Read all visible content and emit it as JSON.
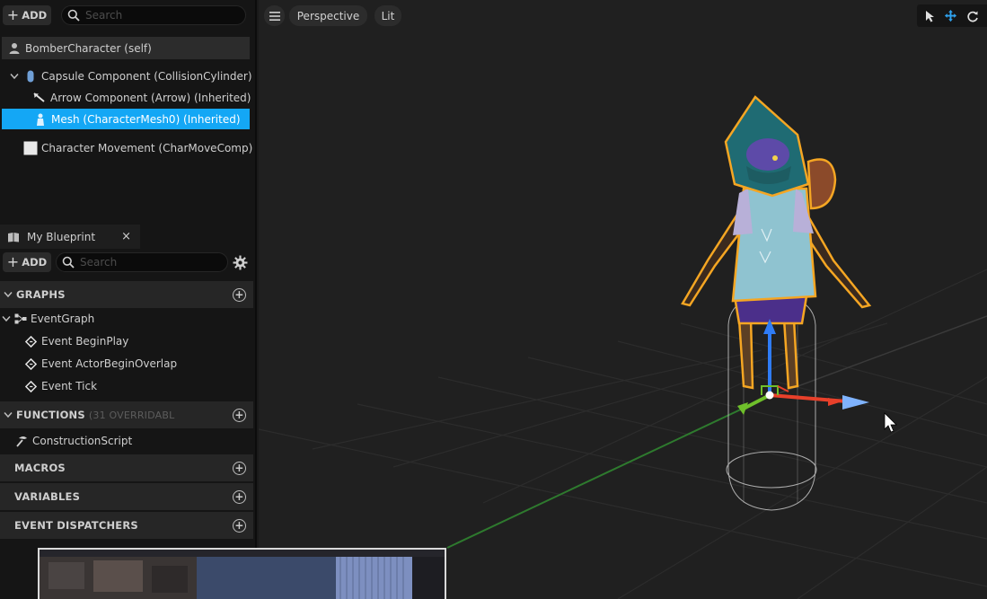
{
  "components": {
    "add_label": "ADD",
    "search_placeholder": "Search",
    "self_label": "BomberCharacter (self)",
    "tree": [
      {
        "label": "Capsule Component (CollisionCylinder) (",
        "icon": "capsule-icon"
      },
      {
        "label": "Arrow Component (Arrow) (Inherited)",
        "icon": "arrow-component-icon"
      },
      {
        "label": "Mesh (CharacterMesh0) (Inherited)",
        "icon": "skeletal-mesh-icon",
        "selected": true
      },
      {
        "label": "Character Movement (CharMoveComp)",
        "icon": "movement-component-icon"
      }
    ]
  },
  "blueprint": {
    "tab_label": "My Blueprint",
    "close_glyph": "×",
    "add_label": "ADD",
    "search_placeholder": "Search",
    "graphs_label": "GRAPHS",
    "event_graph_label": "EventGraph",
    "events": [
      "Event BeginPlay",
      "Event ActorBeginOverlap",
      "Event Tick"
    ],
    "functions_label": "FUNCTIONS",
    "functions_sub": "(31 OVERRIDABL",
    "construction_label": "ConstructionScript",
    "macros_label": "MACROS",
    "variables_label": "VARIABLES",
    "dispatchers_label": "EVENT DISPATCHERS",
    "plus_glyph": "+"
  },
  "viewport": {
    "perspective_label": "Perspective",
    "lit_label": "Lit",
    "menu_icon": "hamburger-icon",
    "tools": [
      "select-icon",
      "translate-icon",
      "rotate-icon"
    ]
  },
  "colors": {
    "selection": "#14a7f5",
    "outline": "#f5a623",
    "axis_x": "#e8402a",
    "axis_y": "#6fbf2b",
    "axis_z": "#2f7cf6"
  }
}
